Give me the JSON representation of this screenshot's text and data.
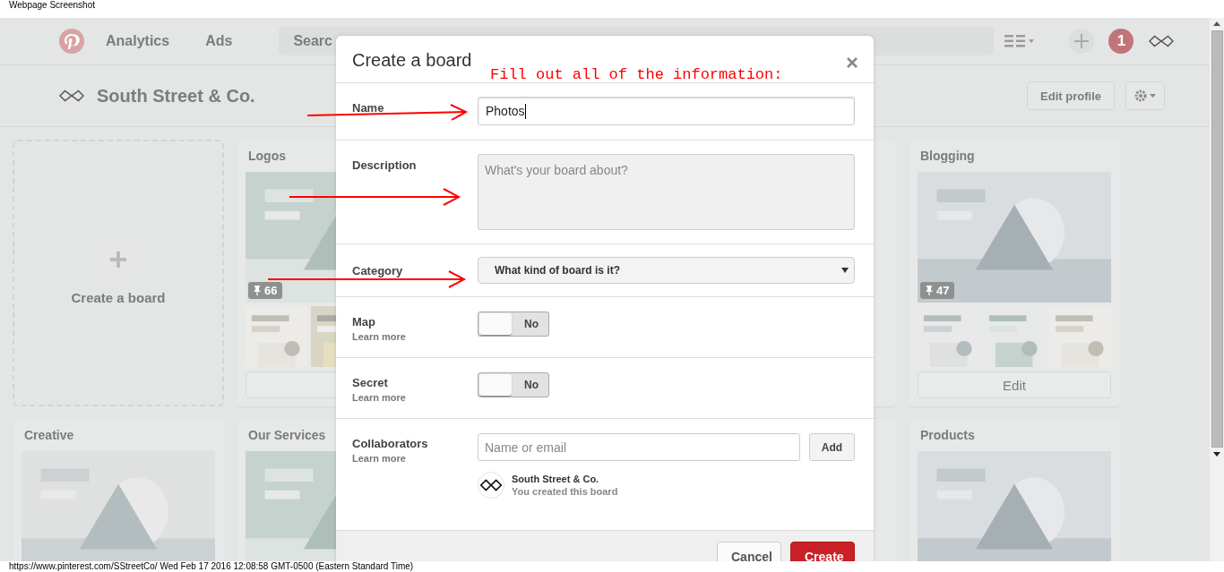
{
  "window": {
    "title": "Webpage Screenshot"
  },
  "nav": {
    "links": [
      "Analytics",
      "Ads"
    ],
    "search": {
      "placeholder": "Searc"
    },
    "notification_count": "1"
  },
  "profile": {
    "name": "South Street & Co.",
    "edit_button": "Edit profile"
  },
  "boards": [
    {
      "kind": "create",
      "label": "Create a board"
    },
    {
      "kind": "board",
      "title": "Logos",
      "pin_count": "66"
    },
    {
      "kind": "hidden"
    },
    {
      "kind": "partial"
    },
    {
      "kind": "board",
      "title": "Blogging",
      "pin_count": "47",
      "edit_button": "Edit"
    },
    {
      "kind": "board",
      "title": "Creative"
    },
    {
      "kind": "board",
      "title": "Our Services"
    },
    {
      "kind": "hidden"
    },
    {
      "kind": "partial"
    },
    {
      "kind": "board",
      "title": "Products"
    }
  ],
  "dialog": {
    "title": "Create a board",
    "note": "Fill out all of the information:",
    "fields": [
      {
        "kind": "text",
        "label": "Name",
        "value": "Photos"
      },
      {
        "kind": "textarea",
        "label": "Description",
        "placeholder": "What's your board about?"
      },
      {
        "kind": "select",
        "label": "Category",
        "value": "What kind of board is it?"
      },
      {
        "kind": "toggle",
        "label": "Map",
        "link": "Learn more",
        "on": false,
        "state_text": "No"
      },
      {
        "kind": "toggle",
        "label": "Secret",
        "link": "Learn more",
        "on": false,
        "state_text": "No"
      },
      {
        "kind": "collaborators",
        "label": "Collaborators",
        "link": "Learn more",
        "placeholder": "Name or email",
        "button": "Add",
        "owner": {
          "name": "South Street & Co.",
          "note": "You created this board"
        }
      }
    ],
    "buttons": [
      {
        "label": "Cancel",
        "kind": "secondary"
      },
      {
        "label": "Create",
        "kind": "primary"
      }
    ]
  },
  "status_bar": "https://www.pinterest.com/SStreetCo/ Wed Feb 17 2016 12:08:58 GMT-0500 (Eastern Standard Time)"
}
